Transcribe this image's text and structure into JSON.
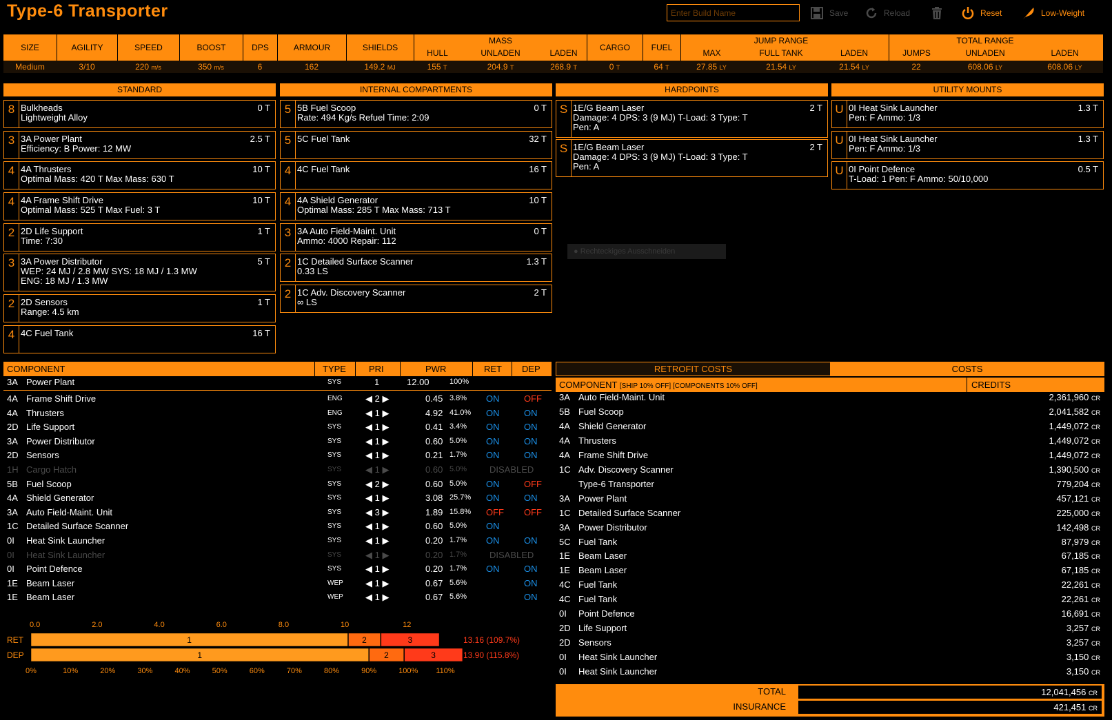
{
  "header": {
    "title": "Type-6 Transporter",
    "build_placeholder": "Enter Build Name",
    "save": "Save",
    "reload": "Reload",
    "reset": "Reset",
    "lowweight": "Low-Weight"
  },
  "stats": {
    "headers": {
      "size": "SIZE",
      "agility": "AGILITY",
      "speed": "SPEED",
      "boost": "BOOST",
      "dps": "DPS",
      "armour": "ARMOUR",
      "shields": "SHIELDS",
      "hull": "HULL",
      "mass": "MASS",
      "unladen": "UNLADEN",
      "laden": "LADEN",
      "cargo": "CARGO",
      "fuel": "FUEL",
      "jump_range": "JUMP RANGE",
      "max": "MAX",
      "full_tank": "FULL TANK",
      "jr_laden": "LADEN",
      "jumps": "JUMPS",
      "total_range": "TOTAL RANGE",
      "tr_unladen": "UNLADEN",
      "tr_laden": "LADEN"
    },
    "values": {
      "size": "Medium",
      "agility": "3/10",
      "speed": "220",
      "speed_u": "m/s",
      "boost": "350",
      "boost_u": "m/s",
      "dps": "6",
      "armour": "162",
      "shields": "149.2",
      "shields_u": "MJ",
      "hull": "155",
      "hull_u": "T",
      "unladen": "204.9",
      "unladen_u": "T",
      "laden": "268.9",
      "laden_u": "T",
      "cargo": "0",
      "cargo_u": "T",
      "fuel": "64",
      "fuel_u": "T",
      "max": "27.85",
      "max_u": "LY",
      "full": "21.54",
      "full_u": "LY",
      "jr_laden": "21.54",
      "jr_laden_u": "LY",
      "jumps": "22",
      "tr_unladen": "608.06",
      "tr_unladen_u": "LY",
      "tr_laden": "608.06",
      "tr_laden_u": "LY"
    }
  },
  "sections": {
    "standard": "STANDARD",
    "internal": "INTERNAL COMPARTMENTS",
    "hardpoints": "HARDPOINTS",
    "utility": "UTILITY MOUNTS"
  },
  "standard": [
    {
      "cls": "8",
      "name": "Bulkheads",
      "mass": "0 T",
      "d1": "Lightweight Alloy",
      "d2": ""
    },
    {
      "cls": "3",
      "name": "3A Power Plant",
      "mass": "2.5 T",
      "d1": "Efficiency: B   Power: 12 MW",
      "d2": ""
    },
    {
      "cls": "4",
      "name": "4A Thrusters",
      "mass": "10 T",
      "d1": "Optimal Mass: 420 T   Max Mass: 630 T",
      "d2": ""
    },
    {
      "cls": "4",
      "name": "4A Frame Shift Drive",
      "mass": "10 T",
      "d1": "Optimal Mass: 525 T   Max Fuel: 3 T",
      "d2": ""
    },
    {
      "cls": "2",
      "name": "2D Life Support",
      "mass": "1 T",
      "d1": "Time: 7:30",
      "d2": ""
    },
    {
      "cls": "3",
      "name": "3A Power Distributor",
      "mass": "5 T",
      "d1": "WEP: 24 MJ / 2.8 MW   SYS: 18 MJ / 1.3 MW",
      "d2": "ENG: 18 MJ / 1.3 MW"
    },
    {
      "cls": "2",
      "name": "2D Sensors",
      "mass": "1 T",
      "d1": "Range: 4.5 km",
      "d2": ""
    },
    {
      "cls": "4",
      "name": "4C Fuel Tank",
      "mass": "16 T",
      "d1": "",
      "d2": ""
    }
  ],
  "internal": [
    {
      "cls": "5",
      "name": "5B Fuel Scoop",
      "mass": "0 T",
      "d1": "Rate: 494 Kg/s   Refuel Time: 2:09"
    },
    {
      "cls": "5",
      "name": "5C Fuel Tank",
      "mass": "32 T",
      "d1": ""
    },
    {
      "cls": "4",
      "name": "4C Fuel Tank",
      "mass": "16 T",
      "d1": ""
    },
    {
      "cls": "4",
      "name": "4A Shield Generator",
      "mass": "10 T",
      "d1": "Optimal Mass: 285 T   Max Mass: 713 T"
    },
    {
      "cls": "3",
      "name": "3A Auto Field-Maint. Unit",
      "mass": "0 T",
      "d1": "Ammo: 4000   Repair: 112"
    },
    {
      "cls": "2",
      "name": "1C Detailed Surface Scanner",
      "mass": "1.3 T",
      "d1": "0.33 LS"
    },
    {
      "cls": "2",
      "name": "1C Adv. Discovery Scanner",
      "mass": "2 T",
      "d1": "∞ LS"
    }
  ],
  "hardpoints": [
    {
      "cls": "S",
      "name": "1E/G Beam Laser",
      "mass": "2 T",
      "d1": "Damage: 4   DPS: 3 (9 MJ)   T-Load: 3   Type: T",
      "d2": "Pen: A"
    },
    {
      "cls": "S",
      "name": "1E/G Beam Laser",
      "mass": "2 T",
      "d1": "Damage: 4   DPS: 3 (9 MJ)   T-Load: 3   Type: T",
      "d2": "Pen: A"
    }
  ],
  "utility": [
    {
      "cls": "U",
      "name": "0I Heat Sink Launcher",
      "mass": "1.3 T",
      "d1": "Pen: F   Ammo: 1/3"
    },
    {
      "cls": "U",
      "name": "0I Heat Sink Launcher",
      "mass": "1.3 T",
      "d1": "Pen: F   Ammo: 1/3"
    },
    {
      "cls": "U",
      "name": "0I Point Defence",
      "mass": "0.5 T",
      "d1": "T-Load: 1   Pen: F   Ammo: 50/10,000"
    }
  ],
  "tooltip": "Rechteckiges Ausschneiden",
  "power": {
    "headers": {
      "component": "COMPONENT",
      "type": "TYPE",
      "pri": "PRI",
      "pwr": "PWR",
      "ret": "RET",
      "dep": "DEP"
    },
    "plant": {
      "grade": "3A",
      "name": "Power Plant",
      "type": "SYS",
      "pri": "1",
      "pwr": "12.00",
      "pct": "100%"
    },
    "rows": [
      {
        "grade": "4A",
        "name": "Frame Shift Drive",
        "type": "ENG",
        "pri": "2",
        "pwr": "0.45",
        "pct": "3.8%",
        "ret": "ON",
        "dep": "OFF"
      },
      {
        "grade": "4A",
        "name": "Thrusters",
        "type": "ENG",
        "pri": "1",
        "pwr": "4.92",
        "pct": "41.0%",
        "ret": "ON",
        "dep": "ON"
      },
      {
        "grade": "2D",
        "name": "Life Support",
        "type": "SYS",
        "pri": "1",
        "pwr": "0.41",
        "pct": "3.4%",
        "ret": "ON",
        "dep": "ON"
      },
      {
        "grade": "3A",
        "name": "Power Distributor",
        "type": "SYS",
        "pri": "1",
        "pwr": "0.60",
        "pct": "5.0%",
        "ret": "ON",
        "dep": "ON"
      },
      {
        "grade": "2D",
        "name": "Sensors",
        "type": "SYS",
        "pri": "1",
        "pwr": "0.21",
        "pct": "1.7%",
        "ret": "ON",
        "dep": "ON"
      },
      {
        "grade": "1H",
        "name": "Cargo Hatch",
        "type": "SYS",
        "pri": "1",
        "pwr": "0.60",
        "pct": "5.0%",
        "status": "DISABLED",
        "disabled": true
      },
      {
        "grade": "5B",
        "name": "Fuel Scoop",
        "type": "SYS",
        "pri": "2",
        "pwr": "0.60",
        "pct": "5.0%",
        "ret": "ON",
        "dep": "OFF"
      },
      {
        "grade": "4A",
        "name": "Shield Generator",
        "type": "SYS",
        "pri": "1",
        "pwr": "3.08",
        "pct": "25.7%",
        "ret": "ON",
        "dep": "ON"
      },
      {
        "grade": "3A",
        "name": "Auto Field-Maint. Unit",
        "type": "SYS",
        "pri": "3",
        "pwr": "1.89",
        "pct": "15.8%",
        "ret": "OFF",
        "dep": "OFF"
      },
      {
        "grade": "1C",
        "name": "Detailed Surface Scanner",
        "type": "SYS",
        "pri": "1",
        "pwr": "0.60",
        "pct": "5.0%",
        "ret": "ON",
        "dep": ""
      },
      {
        "grade": "0I",
        "name": "Heat Sink Launcher",
        "type": "SYS",
        "pri": "1",
        "pwr": "0.20",
        "pct": "1.7%",
        "ret": "ON",
        "dep": "ON"
      },
      {
        "grade": "0I",
        "name": "Heat Sink Launcher",
        "type": "SYS",
        "pri": "1",
        "pwr": "0.20",
        "pct": "1.7%",
        "status": "DISABLED",
        "disabled": true
      },
      {
        "grade": "0I",
        "name": "Point Defence",
        "type": "SYS",
        "pri": "1",
        "pwr": "0.20",
        "pct": "1.7%",
        "ret": "ON",
        "dep": "ON"
      },
      {
        "grade": "1E",
        "name": "Beam Laser",
        "type": "WEP",
        "pri": "1",
        "pwr": "0.67",
        "pct": "5.6%",
        "ret": "",
        "dep": "ON"
      },
      {
        "grade": "1E",
        "name": "Beam Laser",
        "type": "WEP",
        "pri": "1",
        "pwr": "0.67",
        "pct": "5.6%",
        "ret": "",
        "dep": "ON"
      }
    ],
    "bars": {
      "top_ticks": [
        "0.0",
        "2.0",
        "4.0",
        "6.0",
        "8.0",
        "10",
        "12"
      ],
      "bottom_ticks": [
        "0%",
        "10%",
        "20%",
        "30%",
        "40%",
        "50%",
        "60%",
        "70%",
        "80%",
        "90%",
        "100%",
        "110%"
      ],
      "ret_label": "RET",
      "dep_label": "DEP",
      "ret_total": "13.16 (109.7%)",
      "dep_total": "13.90 (115.8%)",
      "ret_segments": [
        {
          "label": "1",
          "value": 10.21
        },
        {
          "label": "2",
          "value": 1.05
        },
        {
          "label": "3",
          "value": 1.89
        }
      ],
      "dep_segments": [
        {
          "label": "1",
          "value": 10.88
        },
        {
          "label": "2",
          "value": 1.13
        },
        {
          "label": "3",
          "value": 1.89
        }
      ],
      "max": 13.8
    }
  },
  "costs": {
    "tab_retrofit": "RETROFIT COSTS",
    "tab_costs": "COSTS",
    "sub_component": "COMPONENT",
    "sub_note": "[SHIP 10% OFF] [COMPONENTS 10% OFF]",
    "sub_credits": "CREDITS",
    "rows": [
      {
        "grade": "3A",
        "name": "Auto Field-Maint. Unit",
        "cr": "2,361,960"
      },
      {
        "grade": "5B",
        "name": "Fuel Scoop",
        "cr": "2,041,582"
      },
      {
        "grade": "4A",
        "name": "Shield Generator",
        "cr": "1,449,072"
      },
      {
        "grade": "4A",
        "name": "Thrusters",
        "cr": "1,449,072"
      },
      {
        "grade": "4A",
        "name": "Frame Shift Drive",
        "cr": "1,449,072"
      },
      {
        "grade": "1C",
        "name": "Adv. Discovery Scanner",
        "cr": "1,390,500"
      },
      {
        "grade": "",
        "name": "Type-6 Transporter",
        "cr": "779,204"
      },
      {
        "grade": "3A",
        "name": "Power Plant",
        "cr": "457,121"
      },
      {
        "grade": "1C",
        "name": "Detailed Surface Scanner",
        "cr": "225,000"
      },
      {
        "grade": "3A",
        "name": "Power Distributor",
        "cr": "142,498"
      },
      {
        "grade": "5C",
        "name": "Fuel Tank",
        "cr": "87,979"
      },
      {
        "grade": "1E",
        "name": "Beam Laser",
        "cr": "67,185"
      },
      {
        "grade": "1E",
        "name": "Beam Laser",
        "cr": "67,185"
      },
      {
        "grade": "4C",
        "name": "Fuel Tank",
        "cr": "22,261"
      },
      {
        "grade": "4C",
        "name": "Fuel Tank",
        "cr": "22,261"
      },
      {
        "grade": "0I",
        "name": "Point Defence",
        "cr": "16,691"
      },
      {
        "grade": "2D",
        "name": "Life Support",
        "cr": "3,257"
      },
      {
        "grade": "2D",
        "name": "Sensors",
        "cr": "3,257"
      },
      {
        "grade": "0I",
        "name": "Heat Sink Launcher",
        "cr": "3,150"
      },
      {
        "grade": "0I",
        "name": "Heat Sink Launcher",
        "cr": "3,150"
      }
    ],
    "cr_unit": "CR",
    "total_label": "TOTAL",
    "total": "12,041,456",
    "insurance_label": "INSURANCE",
    "insurance": "421,451"
  },
  "colors": {
    "accent": "#ff8c0d",
    "on": "#1b90e8",
    "off": "#ff3a1a",
    "bar1": "#ff9a1e",
    "bar2": "#ff6a10",
    "bar3": "#ff3a1a"
  }
}
